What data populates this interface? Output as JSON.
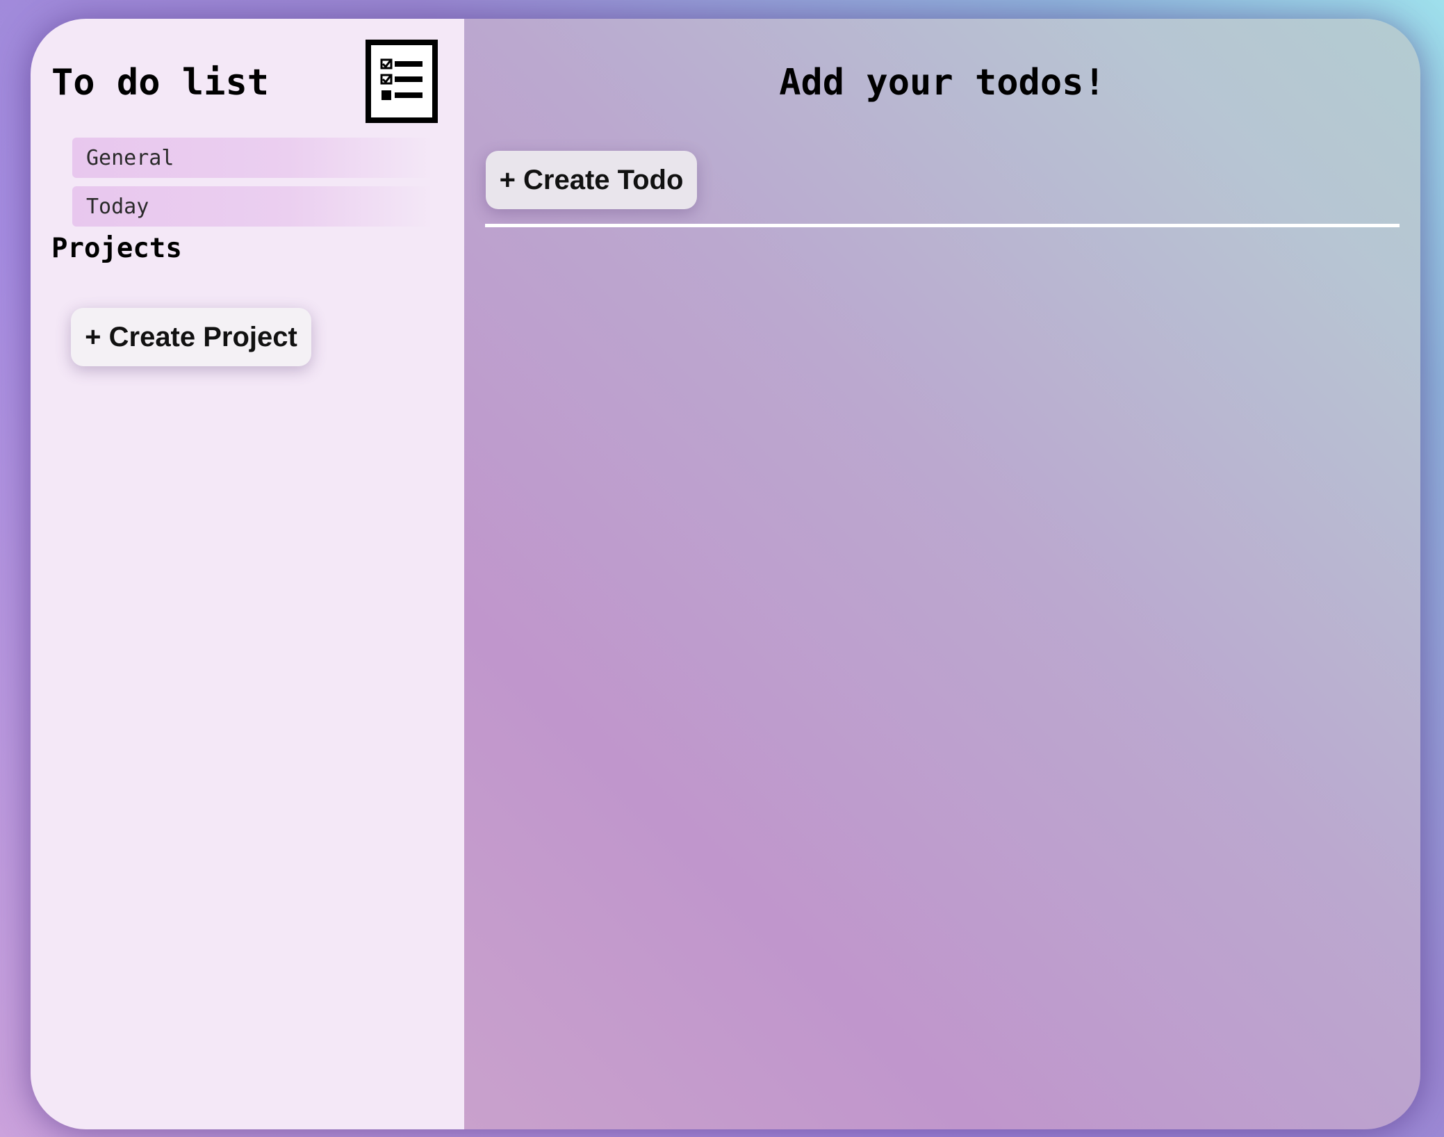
{
  "sidebar": {
    "title": "To do list",
    "logo_icon": "checklist-icon",
    "nav": [
      {
        "label": "General"
      },
      {
        "label": "Today"
      }
    ],
    "projects_heading": "Projects",
    "create_project_label": "+ Create Project"
  },
  "main": {
    "title": "Add your todos!",
    "create_todo_label": "+ Create Todo"
  },
  "colors": {
    "sidebar_bg": "#f4e8f7",
    "nav_item_bg": "#e8c7ee",
    "button_bg": "#f4f1f5",
    "main_gradient_start": "#c096cc",
    "main_gradient_end": "#b3ccd1",
    "divider": "#ffffff"
  }
}
